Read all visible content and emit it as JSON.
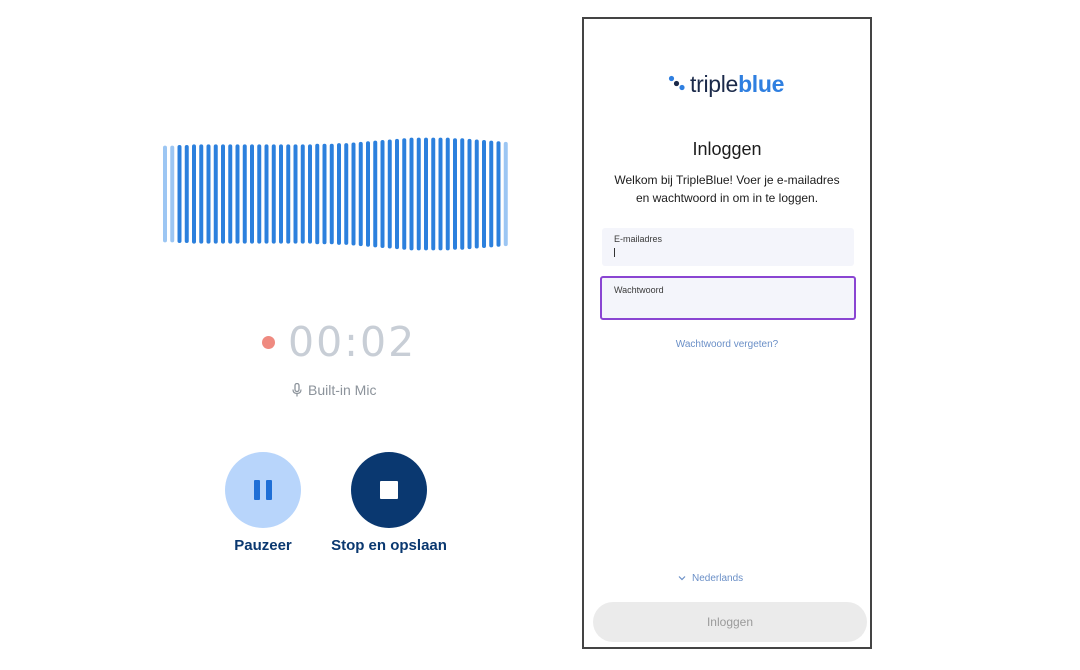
{
  "recorder": {
    "timer": "00:02",
    "mic_label": "Built-in Mic",
    "pause_label": "Pauzeer",
    "stop_label": "Stop en opslaan",
    "colors": {
      "wave_dark": "#2c80dd",
      "wave_light": "#9cc6f3",
      "record_dot": "#ef8a80",
      "pause_bg": "#b8d5fb",
      "stop_bg": "#0a3870"
    },
    "icons": [
      "mic-icon",
      "pause-icon",
      "stop-icon"
    ],
    "waveform_levels": [
      0.78,
      0.78,
      0.79,
      0.79,
      0.8,
      0.8,
      0.8,
      0.8,
      0.8,
      0.8,
      0.8,
      0.8,
      0.8,
      0.8,
      0.8,
      0.8,
      0.8,
      0.8,
      0.8,
      0.8,
      0.8,
      0.81,
      0.81,
      0.81,
      0.82,
      0.82,
      0.83,
      0.84,
      0.85,
      0.86,
      0.87,
      0.88,
      0.89,
      0.9,
      0.91,
      0.91,
      0.91,
      0.91,
      0.91,
      0.91,
      0.9,
      0.9,
      0.89,
      0.88,
      0.87,
      0.86,
      0.85,
      0.84
    ],
    "waveform_light_bars": [
      0,
      1,
      47
    ]
  },
  "login": {
    "brand_part1": "triple",
    "brand_part2": "blue",
    "title": "Inloggen",
    "welcome_line1": "Welkom bij TripleBlue! Voer je e-mailadres",
    "welcome_line2": "en wachtwoord in om in te loggen.",
    "email_label": "E-mailadres",
    "email_value": "",
    "password_label": "Wachtwoord",
    "password_value": "",
    "forgot_link": "Wachtwoord vergeten?",
    "language": "Nederlands",
    "submit_label": "Inloggen",
    "colors": {
      "brand_dark": "#1b2a4a",
      "brand_blue": "#2f7fe0",
      "focus_border": "#8a45d2",
      "link": "#6a8fc7"
    },
    "icons": [
      "logo-dots-icon",
      "chevron-down-icon"
    ]
  }
}
